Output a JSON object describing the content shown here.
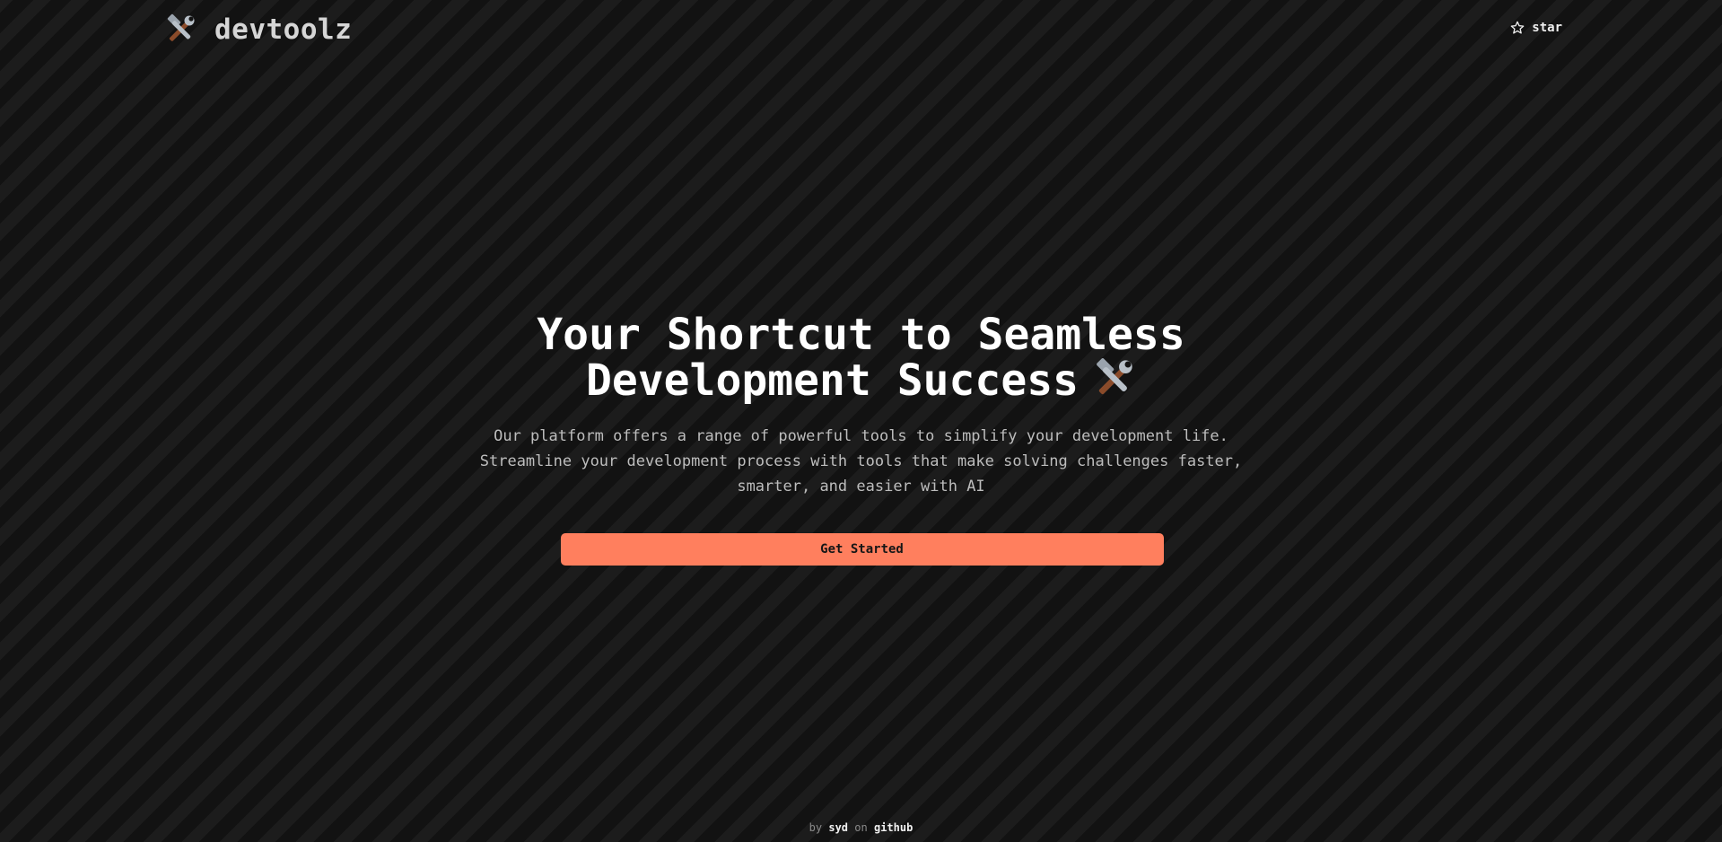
{
  "header": {
    "brand_name": "devtoolz",
    "brand_icon": "hammer-and-wrench-icon",
    "star_label": "star",
    "star_icon": "star-outline-icon"
  },
  "hero": {
    "title_line1": "Your Shortcut to Seamless",
    "title_line2": "Development Success",
    "title_icon": "hammer-and-wrench-icon",
    "description_line1": "Our platform offers a range of powerful tools to simplify your development life.",
    "description_line2": "Streamline your development process with tools that make solving challenges faster,",
    "description_line3": "smarter, and easier with AI",
    "cta_label": "Get Started"
  },
  "footer": {
    "by_text": "by",
    "author": "syd",
    "on_text": "on",
    "platform": "github"
  },
  "colors": {
    "background_dark": "#121212",
    "background_stripe": "#1c1c1c",
    "accent": "#ff7f5e",
    "text_primary": "#ffffff",
    "text_muted": "#bdbdbd"
  }
}
